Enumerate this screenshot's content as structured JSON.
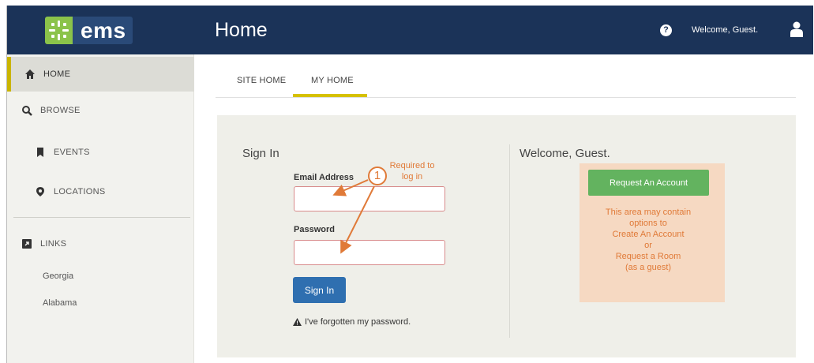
{
  "header": {
    "logo_text": "ems",
    "page_title": "Home",
    "welcome_text": "Welcome, Guest.",
    "brand_color": "#1b3358",
    "logo_accent": "#8bc34a"
  },
  "sidebar": {
    "items": [
      {
        "label": "HOME",
        "icon": "home-icon"
      },
      {
        "label": "BROWSE",
        "icon": "search-icon"
      },
      {
        "label": "EVENTS",
        "icon": "bookmark-icon"
      },
      {
        "label": "LOCATIONS",
        "icon": "map-marker-icon"
      },
      {
        "label": "LINKS",
        "icon": "external-link-icon"
      }
    ],
    "links": [
      "Georgia",
      "Alabama"
    ],
    "active_color": "#c9b400"
  },
  "tabs": [
    {
      "label": "SITE HOME"
    },
    {
      "label": "MY HOME"
    }
  ],
  "signin": {
    "title": "Sign In",
    "email_label": "Email Address",
    "email_value": "",
    "password_label": "Password",
    "password_value": "",
    "button_label": "Sign In",
    "forgot_text": "I've forgotten my password."
  },
  "welcome_panel": {
    "title": "Welcome, Guest.",
    "request_button": "Request An Account",
    "note_lines": [
      "This area may contain",
      "options to",
      "Create An Account",
      "or",
      "Request a Room",
      "(as a guest)"
    ]
  },
  "annotation": {
    "number": "1",
    "text_lines": [
      "Required to",
      "log in"
    ],
    "color": "#e07a38"
  }
}
